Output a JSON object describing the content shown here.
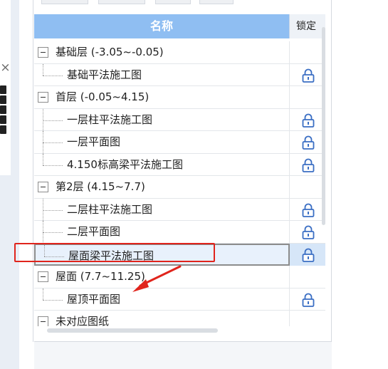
{
  "grid": {
    "header": {
      "name": "名称",
      "lock": "锁定"
    },
    "rows": [
      {
        "type": "group",
        "label": "基础层 (-3.05~-0.05)"
      },
      {
        "type": "child",
        "label": "基础平法施工图",
        "locked": true
      },
      {
        "type": "group",
        "label": "首层 (-0.05~4.15)"
      },
      {
        "type": "child",
        "label": "一层柱平法施工图",
        "locked": true
      },
      {
        "type": "child",
        "label": "一层平面图",
        "locked": true
      },
      {
        "type": "child",
        "label": "4.150标高梁平法施工图",
        "locked": true
      },
      {
        "type": "group",
        "label": "第2层 (4.15~7.7)"
      },
      {
        "type": "child",
        "label": "二层柱平法施工图",
        "locked": true
      },
      {
        "type": "child",
        "label": "二层平面图",
        "locked": true
      },
      {
        "type": "child",
        "label": "屋面梁平法施工图",
        "locked": true,
        "selected": true
      },
      {
        "type": "group",
        "label": "屋面 (7.7~11.25)"
      },
      {
        "type": "child",
        "label": "屋顶平面图",
        "locked": true
      },
      {
        "type": "group",
        "label": "未对应图纸"
      }
    ]
  },
  "left_panel": {
    "close_glyph": "×"
  },
  "icons": {
    "lock": "lock-icon",
    "expander": "collapse-minus-icon",
    "annotation": "red-arrow-icon"
  },
  "colors": {
    "header_bg": "#8fbef2",
    "selection_bg": "#e8f1fc",
    "annotation_red": "#e0241c",
    "lock_blue": "#3b6fc4"
  }
}
